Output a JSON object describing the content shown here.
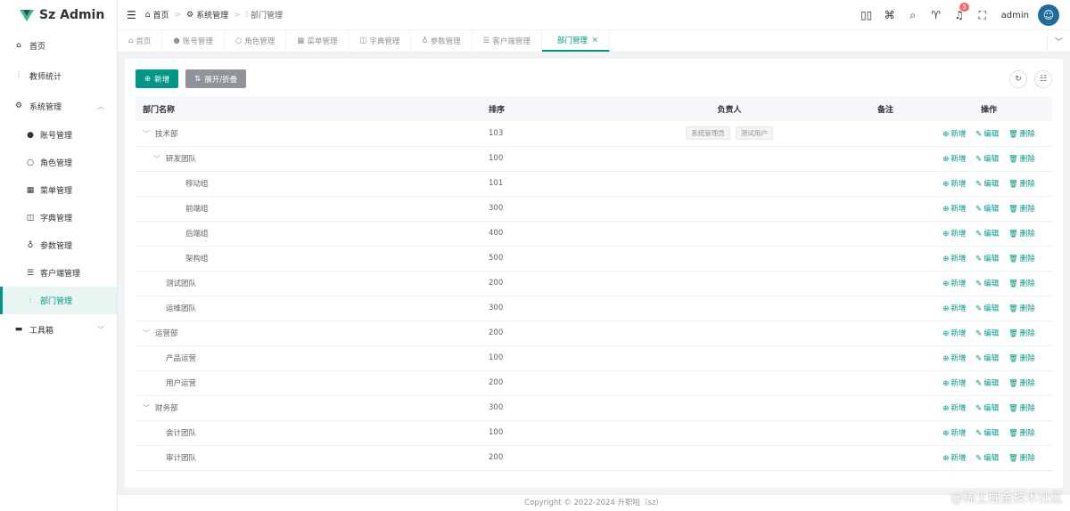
{
  "app": {
    "title": "Sz Admin"
  },
  "sidebar": {
    "items": [
      {
        "label": "首页",
        "icon": "house-icon"
      },
      {
        "label": "教师统计",
        "icon": "chart-icon"
      },
      {
        "label": "系统管理",
        "icon": "gear-icon"
      },
      {
        "label": "工具箱",
        "icon": "toolbox-icon"
      }
    ],
    "sub_items": [
      {
        "label": "账号管理"
      },
      {
        "label": "角色管理"
      },
      {
        "label": "菜单管理"
      },
      {
        "label": "字典管理"
      },
      {
        "label": "参数管理"
      },
      {
        "label": "客户端管理"
      },
      {
        "label": "部门管理"
      }
    ]
  },
  "header": {
    "breadcrumb": [
      "首页",
      "系统管理",
      "部门管理"
    ],
    "notification_count": "5",
    "username": "admin"
  },
  "tabs": [
    "首页",
    "账号管理",
    "角色管理",
    "菜单管理",
    "字典管理",
    "参数管理",
    "客户端管理",
    "部门管理"
  ],
  "toolbar": {
    "add_label": "新增",
    "expand_label": "展开/折叠"
  },
  "table": {
    "headers": {
      "name": "部门名称",
      "sort": "排序",
      "leader": "负责人",
      "note": "备注",
      "ops": "操作"
    },
    "op_labels": {
      "add": "新增",
      "edit": "编辑",
      "delete": "删除"
    },
    "rows": [
      {
        "name": "技术部",
        "sort": "103",
        "level": 0,
        "expandable": true,
        "leaders": [
          "系统管理员",
          "测试用户"
        ]
      },
      {
        "name": "研发团队",
        "sort": "100",
        "level": 1,
        "expandable": true,
        "leaders": []
      },
      {
        "name": "移动组",
        "sort": "101",
        "level": 2,
        "expandable": false,
        "leaders": []
      },
      {
        "name": "前端组",
        "sort": "300",
        "level": 2,
        "expandable": false,
        "leaders": []
      },
      {
        "name": "后端组",
        "sort": "400",
        "level": 2,
        "expandable": false,
        "leaders": []
      },
      {
        "name": "架构组",
        "sort": "500",
        "level": 2,
        "expandable": false,
        "leaders": []
      },
      {
        "name": "测试团队",
        "sort": "200",
        "level": 1,
        "expandable": false,
        "leaders": []
      },
      {
        "name": "运维团队",
        "sort": "300",
        "level": 1,
        "expandable": false,
        "leaders": []
      },
      {
        "name": "运营部",
        "sort": "200",
        "level": 0,
        "expandable": true,
        "leaders": []
      },
      {
        "name": "产品运营",
        "sort": "100",
        "level": 1,
        "expandable": false,
        "leaders": []
      },
      {
        "name": "用户运营",
        "sort": "200",
        "level": 1,
        "expandable": false,
        "leaders": []
      },
      {
        "name": "财务部",
        "sort": "300",
        "level": 0,
        "expandable": true,
        "leaders": []
      },
      {
        "name": "会计团队",
        "sort": "100",
        "level": 1,
        "expandable": false,
        "leaders": []
      },
      {
        "name": "审计团队",
        "sort": "200",
        "level": 1,
        "expandable": false,
        "leaders": []
      }
    ]
  },
  "footer": {
    "text": "Copyright © 2022-2024 升职啦（sz）"
  },
  "watermark": "@稀土掘金技术社区",
  "colors": {
    "primary": "#009688",
    "danger": "#f56c6c"
  }
}
